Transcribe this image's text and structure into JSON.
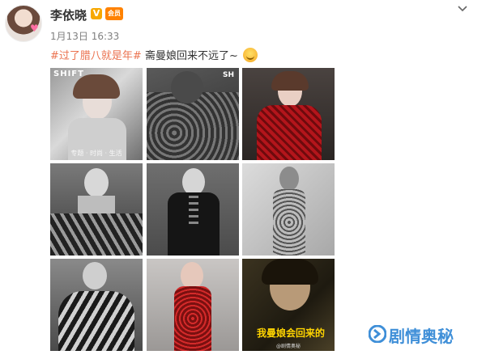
{
  "post": {
    "username": "李依晓",
    "timestamp": "1月13日 16:33",
    "hashtag": "#过了腊八就是年#",
    "text": "斋曼娘回来不远了~",
    "v_badge": "V",
    "member_badge": "会员"
  },
  "photos": [
    {
      "caption": "专题 · 时尚 · 生活",
      "brand": "SHIFT"
    },
    {
      "brand_right": "SH"
    },
    {},
    {},
    {},
    {},
    {},
    {},
    {
      "subtitle": "我曼娘会回来的",
      "watermark": "@剧情奥秘"
    }
  ],
  "watermark": {
    "text": "剧情奥秘"
  },
  "icons": [
    "avatar",
    "verified-badge",
    "member-badge",
    "chevron-down-icon",
    "smile-emoji-icon",
    "watermark-logo-icon"
  ]
}
